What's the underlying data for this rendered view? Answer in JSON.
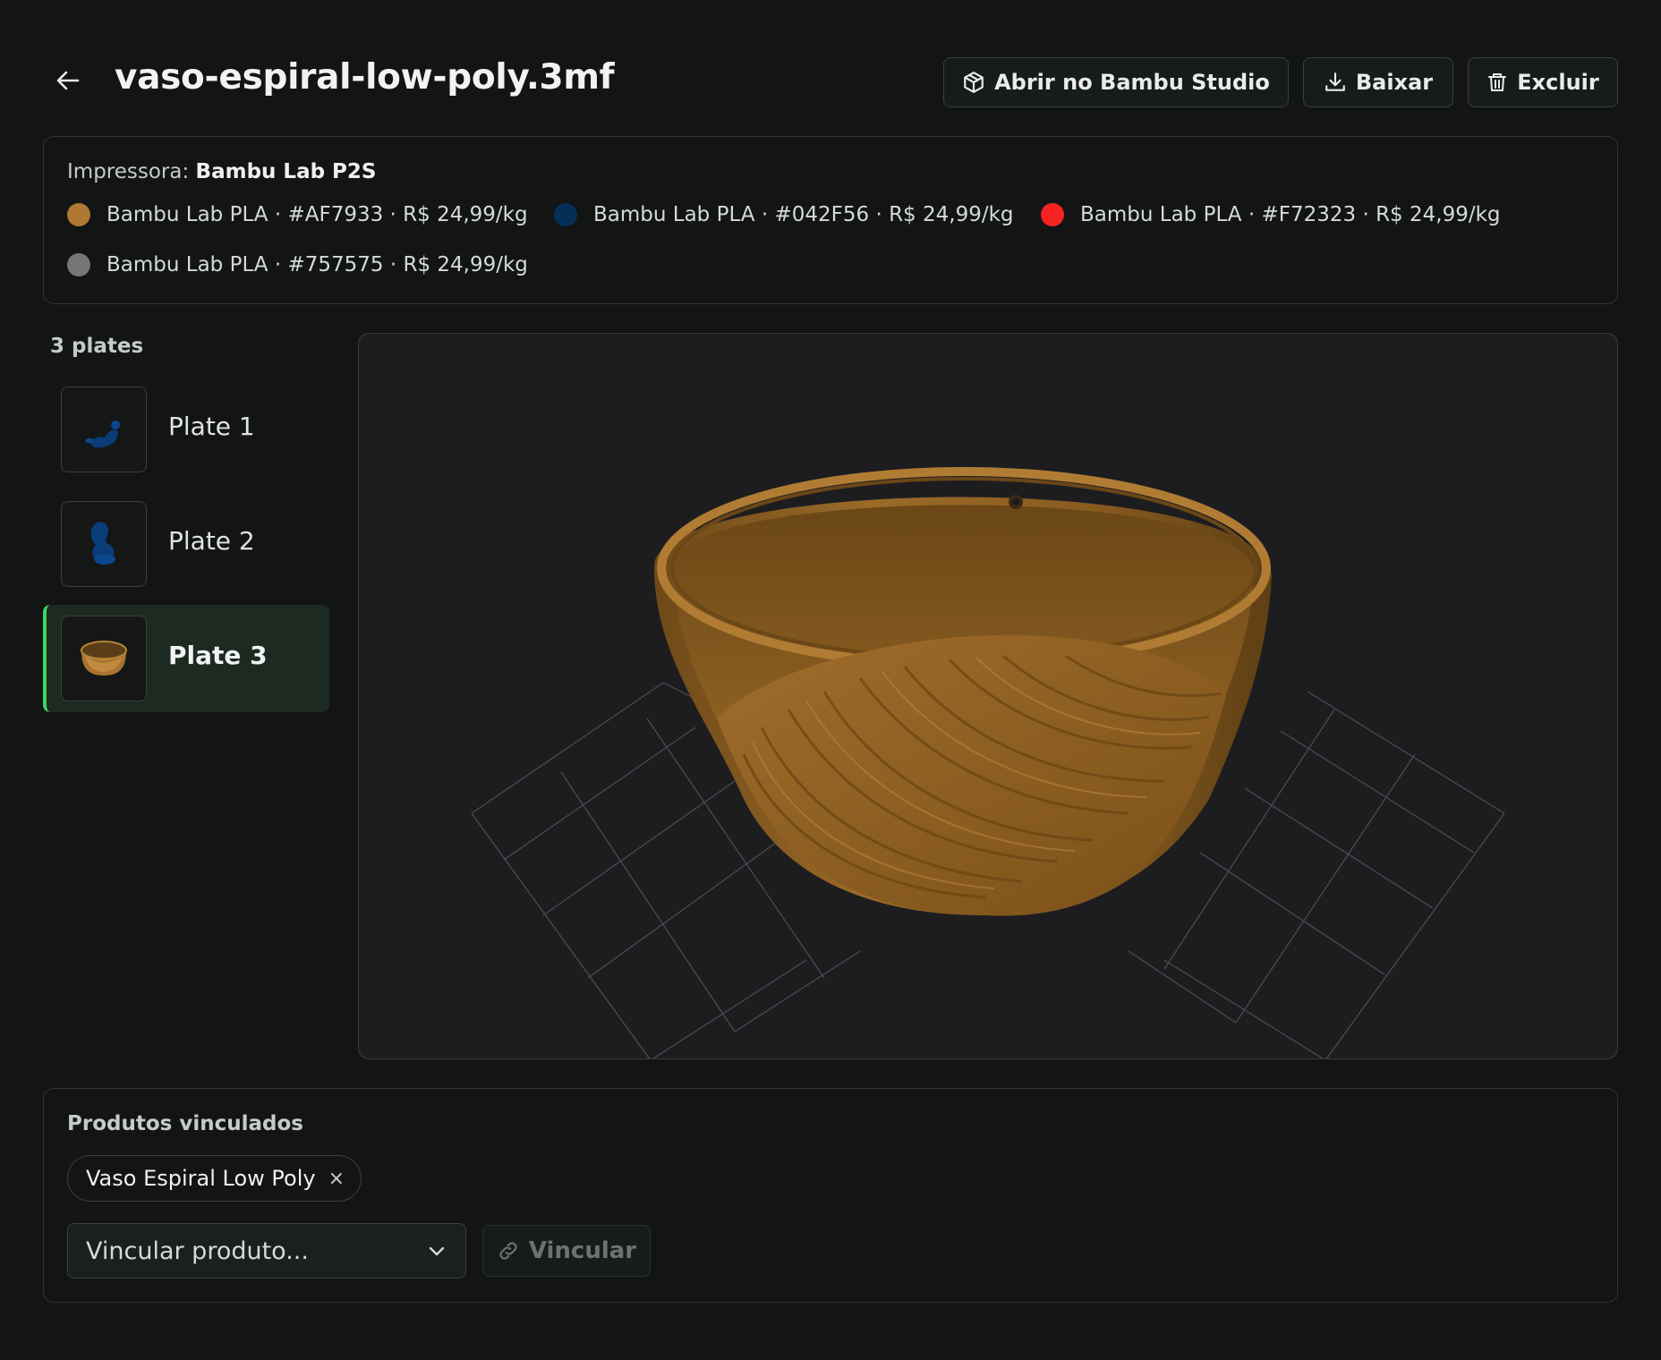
{
  "header": {
    "title": "vaso-espiral-low-poly.3mf",
    "actions": {
      "open_label": "Abrir no Bambu Studio",
      "download_label": "Baixar",
      "delete_label": "Excluir"
    }
  },
  "printer": {
    "label": "Impressora:",
    "name": "Bambu Lab P2S"
  },
  "filaments": [
    {
      "text": "Bambu Lab PLA · #AF7933 · R$ 24,99/kg",
      "color": "#AF7933"
    },
    {
      "text": "Bambu Lab PLA · #042F56 · R$ 24,99/kg",
      "color": "#042F56"
    },
    {
      "text": "Bambu Lab PLA · #F72323 · R$ 24,99/kg",
      "color": "#F72323"
    },
    {
      "text": "Bambu Lab PLA · #757575 · R$ 24,99/kg",
      "color": "#757575"
    }
  ],
  "plates": {
    "count_label": "3 plates",
    "items": [
      {
        "label": "Plate 1",
        "active": false
      },
      {
        "label": "Plate 2",
        "active": false
      },
      {
        "label": "Plate 3",
        "active": true
      }
    ]
  },
  "products": {
    "title": "Produtos vinculados",
    "linked": [
      {
        "name": "Vaso Espiral Low Poly",
        "remove_glyph": "×"
      }
    ],
    "select_placeholder": "Vincular produto...",
    "link_button": "Vincular"
  },
  "colors": {
    "accent": "#3ED266",
    "model": "#AF7933"
  }
}
